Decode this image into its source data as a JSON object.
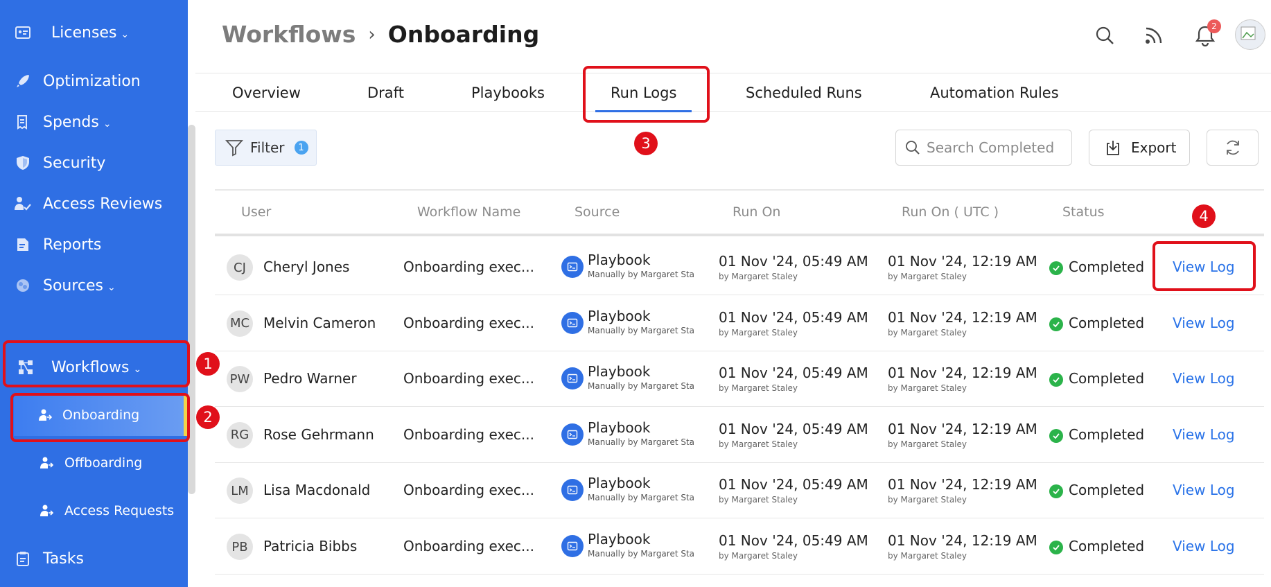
{
  "sidebar": {
    "items": [
      {
        "label": "Licenses",
        "icon": "id-card-icon",
        "has_chevron": true
      },
      {
        "label": "Optimization",
        "icon": "rocket-icon",
        "has_chevron": false
      },
      {
        "label": "Spends",
        "icon": "receipt-icon",
        "has_chevron": true
      },
      {
        "label": "Security",
        "icon": "shield-icon",
        "has_chevron": false
      },
      {
        "label": "Access Reviews",
        "icon": "user-check-icon",
        "has_chevron": false
      },
      {
        "label": "Reports",
        "icon": "report-icon",
        "has_chevron": false
      },
      {
        "label": "Sources",
        "icon": "sources-icon",
        "has_chevron": true
      },
      {
        "label": "Workflows",
        "icon": "workflow-icon",
        "has_chevron": true
      },
      {
        "label": "Tasks",
        "icon": "clipboard-icon",
        "has_chevron": false
      }
    ],
    "sub_items": [
      {
        "label": "Onboarding",
        "icon": "user-arrow-icon",
        "active": true
      },
      {
        "label": "Offboarding",
        "icon": "user-arrow-icon",
        "active": false
      },
      {
        "label": "Access Requests",
        "icon": "user-arrow-icon",
        "active": false
      }
    ],
    "chevron": "⌄"
  },
  "annotations": [
    "1",
    "2",
    "3",
    "4"
  ],
  "header": {
    "breadcrumb_parent": "Workflows",
    "breadcrumb_sep": "›",
    "breadcrumb_current": "Onboarding",
    "notification_count": "2"
  },
  "tabs": [
    {
      "label": "Overview",
      "active": false
    },
    {
      "label": "Draft",
      "active": false
    },
    {
      "label": "Playbooks",
      "active": false
    },
    {
      "label": "Run Logs",
      "active": true
    },
    {
      "label": "Scheduled Runs",
      "active": false
    },
    {
      "label": "Automation Rules",
      "active": false
    }
  ],
  "toolbar": {
    "filter_label": "Filter",
    "filter_count": "1",
    "search_placeholder": "Search Completed",
    "export_label": "Export"
  },
  "table": {
    "columns": [
      "User",
      "Workflow Name",
      "Source",
      "Run On",
      "Run On ( UTC )",
      "Status"
    ],
    "rows": [
      {
        "initials": "CJ",
        "user": "Cheryl Jones",
        "workflow": "Onboarding exec...",
        "source": "Playbook",
        "source_sub": "Manually by Margaret Staley",
        "run_on": "01 Nov '24, 05:49 AM",
        "run_on_by": "by Margaret Staley",
        "run_utc": "01 Nov '24, 12:19 AM",
        "run_utc_by": "by Margaret Staley",
        "status": "Completed",
        "action": "View Log"
      },
      {
        "initials": "MC",
        "user": "Melvin Cameron",
        "workflow": "Onboarding exec...",
        "source": "Playbook",
        "source_sub": "Manually by Margaret Staley",
        "run_on": "01 Nov '24, 05:49 AM",
        "run_on_by": "by Margaret Staley",
        "run_utc": "01 Nov '24, 12:19 AM",
        "run_utc_by": "by Margaret Staley",
        "status": "Completed",
        "action": "View Log"
      },
      {
        "initials": "PW",
        "user": "Pedro Warner",
        "workflow": "Onboarding exec...",
        "source": "Playbook",
        "source_sub": "Manually by Margaret Staley",
        "run_on": "01 Nov '24, 05:49 AM",
        "run_on_by": "by Margaret Staley",
        "run_utc": "01 Nov '24, 12:19 AM",
        "run_utc_by": "by Margaret Staley",
        "status": "Completed",
        "action": "View Log"
      },
      {
        "initials": "RG",
        "user": "Rose Gehrmann",
        "workflow": "Onboarding exec...",
        "source": "Playbook",
        "source_sub": "Manually by Margaret Staley",
        "run_on": "01 Nov '24, 05:49 AM",
        "run_on_by": "by Margaret Staley",
        "run_utc": "01 Nov '24, 12:19 AM",
        "run_utc_by": "by Margaret Staley",
        "status": "Completed",
        "action": "View Log"
      },
      {
        "initials": "LM",
        "user": "Lisa Macdonald",
        "workflow": "Onboarding exec...",
        "source": "Playbook",
        "source_sub": "Manually by Margaret Staley",
        "run_on": "01 Nov '24, 05:49 AM",
        "run_on_by": "by Margaret Staley",
        "run_utc": "01 Nov '24, 12:19 AM",
        "run_utc_by": "by Margaret Staley",
        "status": "Completed",
        "action": "View Log"
      },
      {
        "initials": "PB",
        "user": "Patricia Bibbs",
        "workflow": "Onboarding exec...",
        "source": "Playbook",
        "source_sub": "Manually by Margaret Staley",
        "run_on": "01 Nov '24, 05:49 AM",
        "run_on_by": "by Margaret Staley",
        "run_utc": "01 Nov '24, 12:19 AM",
        "run_utc_by": "by Margaret Staley",
        "status": "Completed",
        "action": "View Log"
      }
    ]
  },
  "colors": {
    "sidebar_bg": "#2f6fe4",
    "accent": "#2f6fe4",
    "annotation": "#e0101a",
    "link": "#2a73e8",
    "success": "#2bb34a",
    "active_marker": "#f2d34a"
  }
}
